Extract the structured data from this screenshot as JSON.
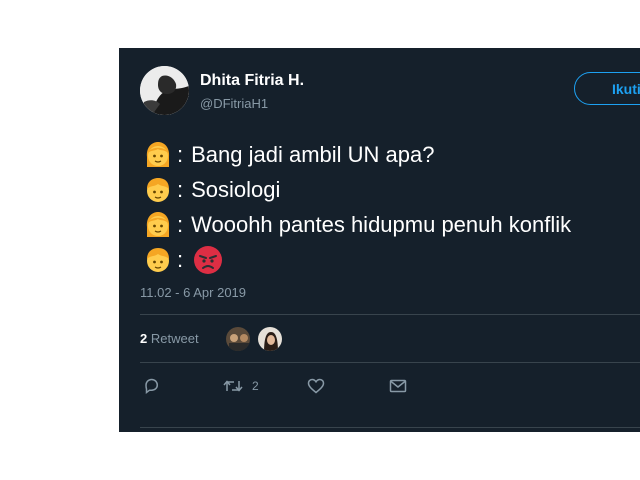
{
  "tweet": {
    "author": {
      "display_name": "Dhita Fitria H.",
      "handle": "@DFitriaH1"
    },
    "follow_label": "Ikuti",
    "lines": [
      {
        "speaker": "girl-emoji",
        "text": "Bang jadi ambil UN apa?"
      },
      {
        "speaker": "boy-emoji",
        "text": "Sosiologi"
      },
      {
        "speaker": "girl-emoji",
        "text": "Wooohh pantes hidupmu penuh konflik"
      },
      {
        "speaker": "boy-emoji",
        "text": "",
        "reaction": "angry-face-emoji"
      }
    ],
    "timestamp": "11.02 - 6 Apr 2019",
    "retweets": {
      "count": "2",
      "label": "Retweet"
    },
    "actions": {
      "reply": {
        "icon": "reply-icon"
      },
      "retweet": {
        "icon": "retweet-icon",
        "count": "2"
      },
      "like": {
        "icon": "heart-icon"
      },
      "message": {
        "icon": "envelope-icon"
      }
    }
  },
  "theme": {
    "background": "#15202b",
    "text": "#ffffff",
    "muted": "#8899a6",
    "accent": "#1da1f2",
    "divider": "#38444d"
  }
}
